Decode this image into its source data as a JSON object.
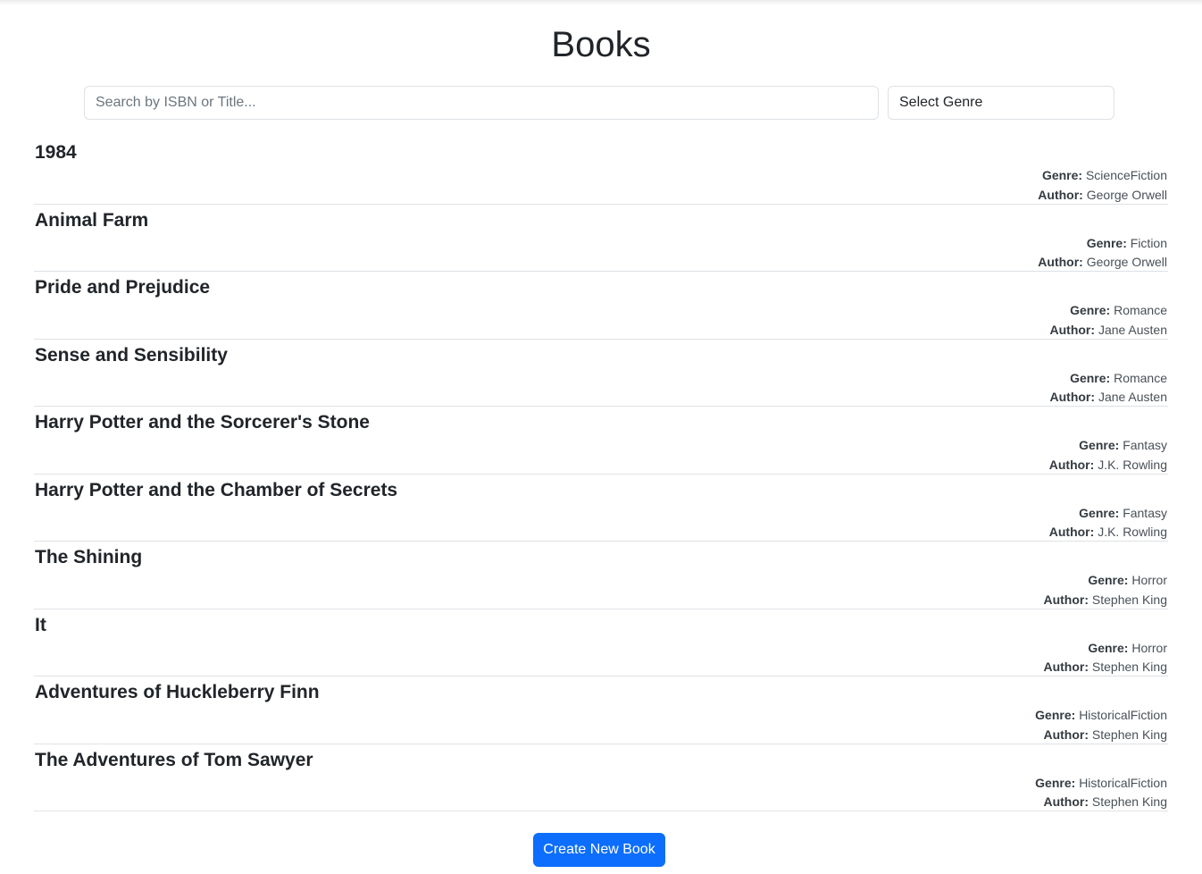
{
  "header": {
    "title": "Books"
  },
  "filters": {
    "search_placeholder": "Search by ISBN or Title...",
    "search_value": "",
    "genre_select_value": "Select Genre"
  },
  "labels": {
    "genre": "Genre:",
    "author": "Author:"
  },
  "books": [
    {
      "title": "1984",
      "genre": "ScienceFiction",
      "author": "George Orwell"
    },
    {
      "title": "Animal Farm",
      "genre": "Fiction",
      "author": "George Orwell"
    },
    {
      "title": "Pride and Prejudice",
      "genre": "Romance",
      "author": "Jane Austen"
    },
    {
      "title": "Sense and Sensibility",
      "genre": "Romance",
      "author": "Jane Austen"
    },
    {
      "title": "Harry Potter and the Sorcerer's Stone",
      "genre": "Fantasy",
      "author": "J.K. Rowling"
    },
    {
      "title": "Harry Potter and the Chamber of Secrets",
      "genre": "Fantasy",
      "author": "J.K. Rowling"
    },
    {
      "title": "The Shining",
      "genre": "Horror",
      "author": "Stephen King"
    },
    {
      "title": "It",
      "genre": "Horror",
      "author": "Stephen King"
    },
    {
      "title": "Adventures of Huckleberry Finn",
      "genre": "HistoricalFiction",
      "author": "Stephen King"
    },
    {
      "title": "The Adventures of Tom Sawyer",
      "genre": "HistoricalFiction",
      "author": "Stephen King"
    }
  ],
  "actions": {
    "create_label": "Create New Book"
  },
  "colors": {
    "primary": "#0d6efd",
    "border": "#dee2e6",
    "text": "#212529"
  }
}
